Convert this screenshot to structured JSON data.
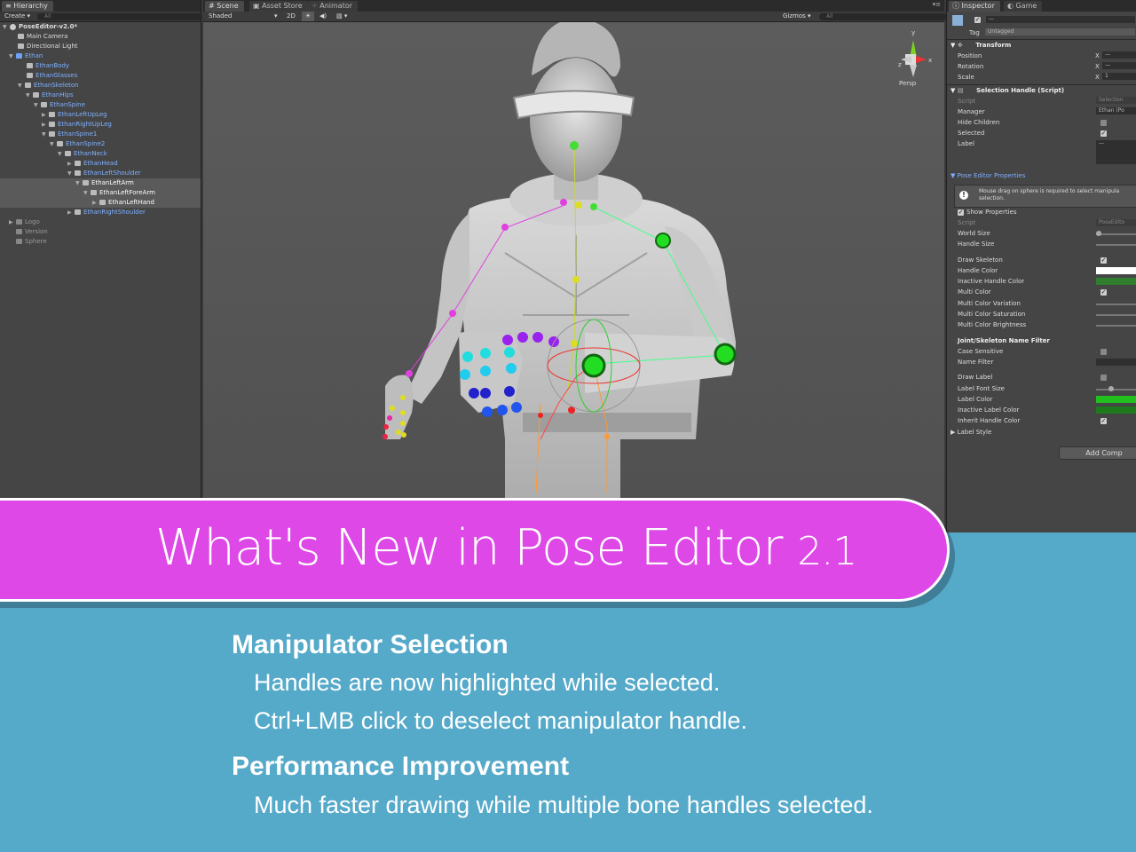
{
  "hierarchy": {
    "tab_label": "Hierarchy",
    "create_label": "Create",
    "search_placeholder": "All",
    "scene_name": "PoseEditor-v2.0*",
    "items": [
      {
        "label": "Main Camera"
      },
      {
        "label": "Directional Light"
      },
      {
        "label": "Ethan"
      },
      {
        "label": "EthanBody"
      },
      {
        "label": "EthanGlasses"
      },
      {
        "label": "EthanSkeleton"
      },
      {
        "label": "EthanHips"
      },
      {
        "label": "EthanSpine"
      },
      {
        "label": "EthanLeftUpLeg"
      },
      {
        "label": "EthanRightUpLeg"
      },
      {
        "label": "EthanSpine1"
      },
      {
        "label": "EthanSpine2"
      },
      {
        "label": "EthanNeck"
      },
      {
        "label": "EthanHead"
      },
      {
        "label": "EthanLeftShoulder"
      },
      {
        "label": "EthanLeftArm"
      },
      {
        "label": "EthanLeftForeArm"
      },
      {
        "label": "EthanLeftHand"
      },
      {
        "label": "EthanRightShoulder"
      },
      {
        "label": "Logo"
      },
      {
        "label": "Version"
      },
      {
        "label": "Sphere"
      }
    ]
  },
  "scene": {
    "tabs": [
      {
        "label": "Scene"
      },
      {
        "label": "Asset Store"
      },
      {
        "label": "Animator"
      }
    ],
    "shading_mode": "Shaded",
    "mode_2d": "2D",
    "gizmos_label": "Gizmos",
    "search_placeholder": "All",
    "persp_label": "Persp",
    "gizmo_axes": {
      "y": "y",
      "x": "x",
      "z": "z"
    }
  },
  "inspector": {
    "tabs": [
      {
        "label": "Inspector"
      },
      {
        "label": "Game"
      }
    ],
    "name_value": "—",
    "tag_label": "Tag",
    "tag_value": "Untagged",
    "transform": {
      "title": "Transform",
      "position_label": "Position",
      "rotation_label": "Rotation",
      "scale_label": "Scale",
      "axis": "X",
      "position_value": "—",
      "rotation_value": "—",
      "scale_value": "1"
    },
    "selection_handle": {
      "title": "Selection Handle (Script)",
      "script_label": "Script",
      "script_value": "Selection",
      "manager_label": "Manager",
      "manager_value": "Ethan (Po",
      "hide_children_label": "Hide Children",
      "selected_label": "Selected",
      "label_label": "Label",
      "label_value": "—"
    },
    "pose_editor": {
      "title": "Pose Editor Properties",
      "note": "Mouse drag on sphere is required to select manipula",
      "note2": "selection.",
      "show_properties": "Show Properties",
      "script_label": "Script",
      "script_value": "PoseEdito",
      "world_size": "World Size",
      "handle_size": "Handle Size",
      "draw_skeleton": "Draw Skeleton",
      "handle_color": "Handle Color",
      "inactive_handle_color": "Inactive Handle Color",
      "multi_color": "Multi Color",
      "multi_color_variation": "Multi Color Variation",
      "multi_color_saturation": "Multi Color Saturation",
      "multi_color_brightness": "Multi Color Brightness",
      "filter_title": "Joint/Skeleton Name Filter",
      "case_sensitive": "Case Sensitive",
      "name_filter": "Name Filter",
      "draw_label": "Draw Label",
      "label_font_size": "Label Font Size",
      "label_color": "Label Color",
      "inactive_label_color": "Inactive Label Color",
      "inherit_handle_color": "Inherit Handle Color",
      "label_style": "Label Style"
    },
    "add_component": "Add Comp",
    "colors": {
      "handle_color": "#ffffff",
      "inactive_handle_color": "#2f7f2f",
      "label_color": "#22c01e",
      "inactive_label_color": "#1f7a1d"
    }
  },
  "banner": {
    "title_main": "What's New in Pose Editor ",
    "title_version": "2.1",
    "color": "#dd48e6"
  },
  "content": {
    "section1": {
      "heading": "Manipulator Selection",
      "lines": [
        "Handles are now highlighted while selected.",
        "Ctrl+LMB click to deselect manipulator handle."
      ]
    },
    "section2": {
      "heading": "Performance Improvement",
      "lines": [
        "Much faster drawing while multiple bone handles selected."
      ]
    },
    "background": "#55a9c9"
  }
}
